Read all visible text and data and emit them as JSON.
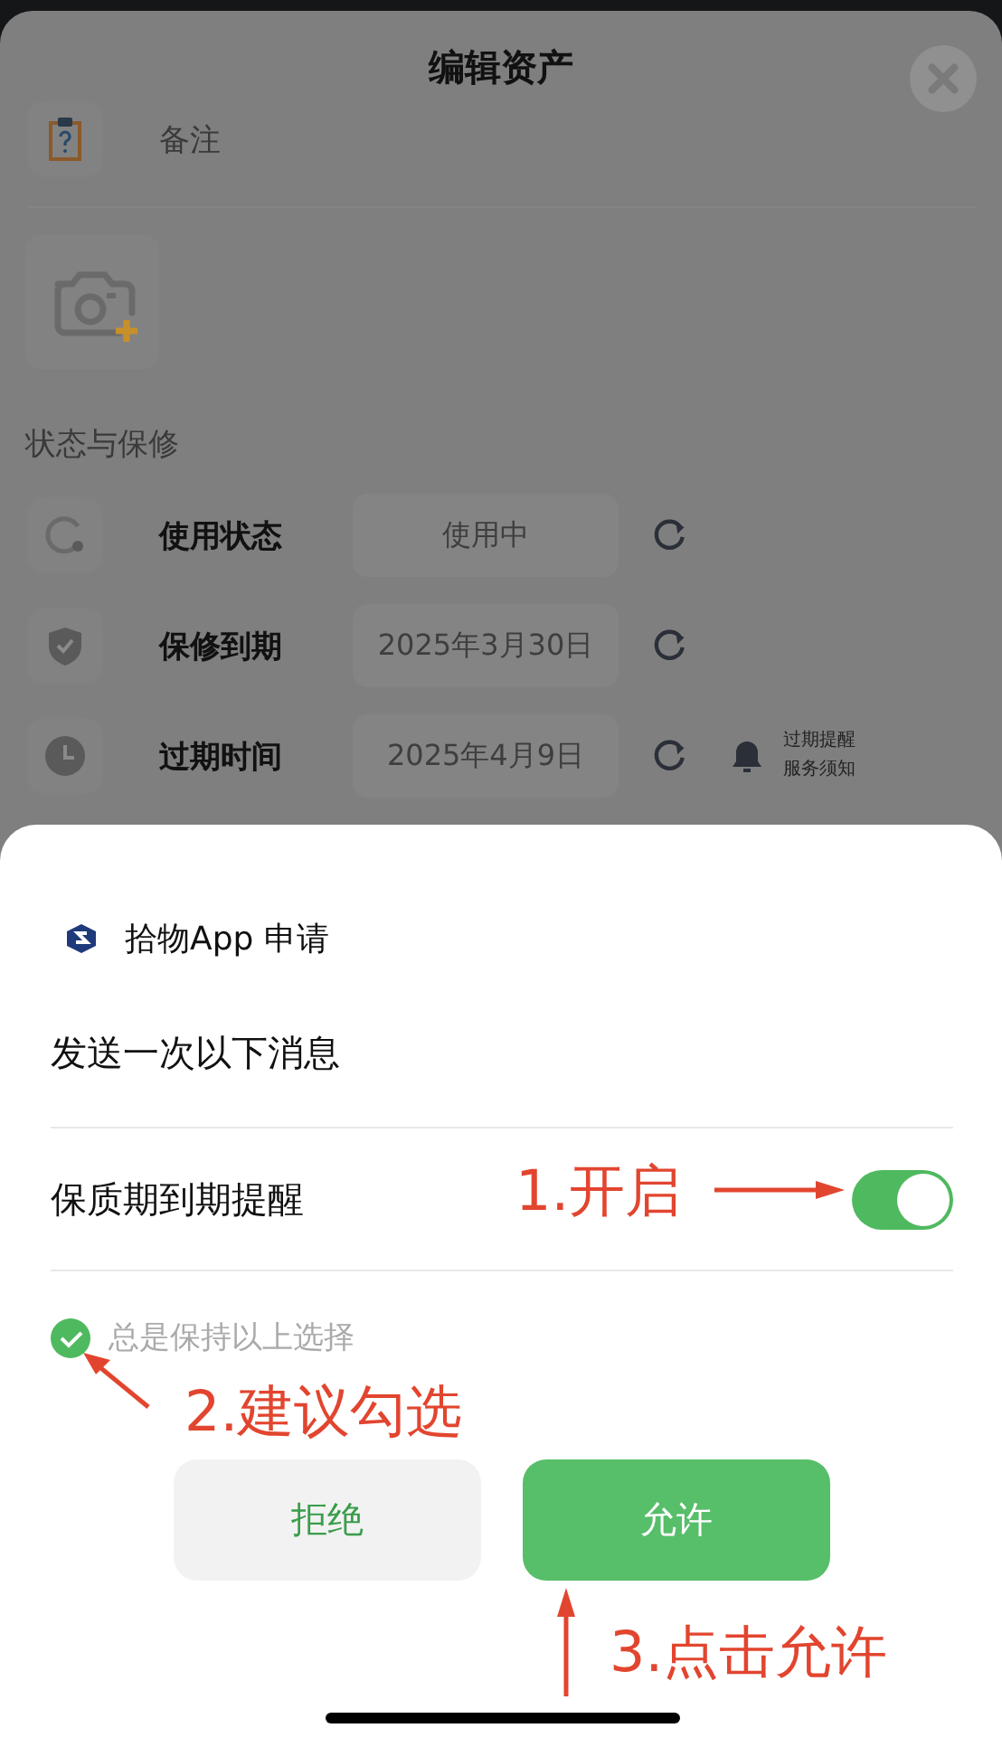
{
  "background_sheet": {
    "title": "编辑资产",
    "note": {
      "label": "备注"
    },
    "section_title": "状态与保修",
    "rows": [
      {
        "label": "使用状态",
        "value": "使用中"
      },
      {
        "label": "保修到期",
        "value": "2025年3月30日"
      },
      {
        "label": "过期时间",
        "value": "2025年4月9日",
        "reminder": [
          "过期提醒",
          "服务须知"
        ]
      }
    ]
  },
  "dialog": {
    "app_name": "拾物App 申请",
    "heading": "发送一次以下消息",
    "options": [
      {
        "label": "保质期到期提醒",
        "on": true
      }
    ],
    "always_keep": {
      "label": "总是保持以上选择",
      "checked": true
    },
    "buttons": [
      {
        "label": "拒绝",
        "kind": "secondary"
      },
      {
        "label": "允许",
        "kind": "primary"
      }
    ]
  },
  "annotations": [
    {
      "text": "1.开启"
    },
    {
      "text": "2.建议勾选"
    },
    {
      "text": "3.点击允许"
    }
  ]
}
